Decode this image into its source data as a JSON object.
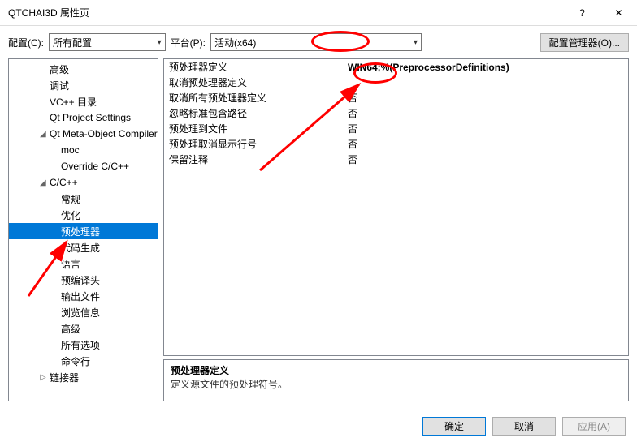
{
  "titlebar": {
    "title": "QTCHAI3D 属性页",
    "help": "?",
    "close": "✕"
  },
  "config": {
    "label": "配置(C):",
    "value": "所有配置",
    "platform_label": "平台(P):",
    "platform_value": "活动(x64)",
    "manager_button": "配置管理器(O)..."
  },
  "tree": [
    {
      "label": "高级",
      "level": 2,
      "exp": ""
    },
    {
      "label": "调试",
      "level": 2,
      "exp": ""
    },
    {
      "label": "VC++ 目录",
      "level": 2,
      "exp": ""
    },
    {
      "label": "Qt Project Settings",
      "level": 2,
      "exp": ""
    },
    {
      "label": "Qt Meta-Object Compiler",
      "level": 2,
      "exp": "◢"
    },
    {
      "label": "moc",
      "level": 3,
      "exp": ""
    },
    {
      "label": "Override C/C++",
      "level": 3,
      "exp": ""
    },
    {
      "label": "C/C++",
      "level": 2,
      "exp": "◢"
    },
    {
      "label": "常规",
      "level": 3,
      "exp": ""
    },
    {
      "label": "优化",
      "level": 3,
      "exp": ""
    },
    {
      "label": "预处理器",
      "level": 3,
      "exp": "",
      "selected": true
    },
    {
      "label": "代码生成",
      "level": 3,
      "exp": ""
    },
    {
      "label": "语言",
      "level": 3,
      "exp": ""
    },
    {
      "label": "预编译头",
      "level": 3,
      "exp": ""
    },
    {
      "label": "输出文件",
      "level": 3,
      "exp": ""
    },
    {
      "label": "浏览信息",
      "level": 3,
      "exp": ""
    },
    {
      "label": "高级",
      "level": 3,
      "exp": ""
    },
    {
      "label": "所有选项",
      "level": 3,
      "exp": ""
    },
    {
      "label": "命令行",
      "level": 3,
      "exp": ""
    },
    {
      "label": "链接器",
      "level": 2,
      "exp": "▷"
    }
  ],
  "props": [
    {
      "key": "预处理器定义",
      "value": "WIN64;%(PreprocessorDefinitions)",
      "bold": true
    },
    {
      "key": "取消预处理器定义",
      "value": ""
    },
    {
      "key": "取消所有预处理器定义",
      "value": "否"
    },
    {
      "key": "忽略标准包含路径",
      "value": "否"
    },
    {
      "key": "预处理到文件",
      "value": "否"
    },
    {
      "key": "预处理取消显示行号",
      "value": "否"
    },
    {
      "key": "保留注释",
      "value": "否"
    }
  ],
  "description": {
    "title": "预处理器定义",
    "body": "定义源文件的预处理符号。"
  },
  "footer": {
    "ok": "确定",
    "cancel": "取消",
    "apply": "应用(A)"
  }
}
